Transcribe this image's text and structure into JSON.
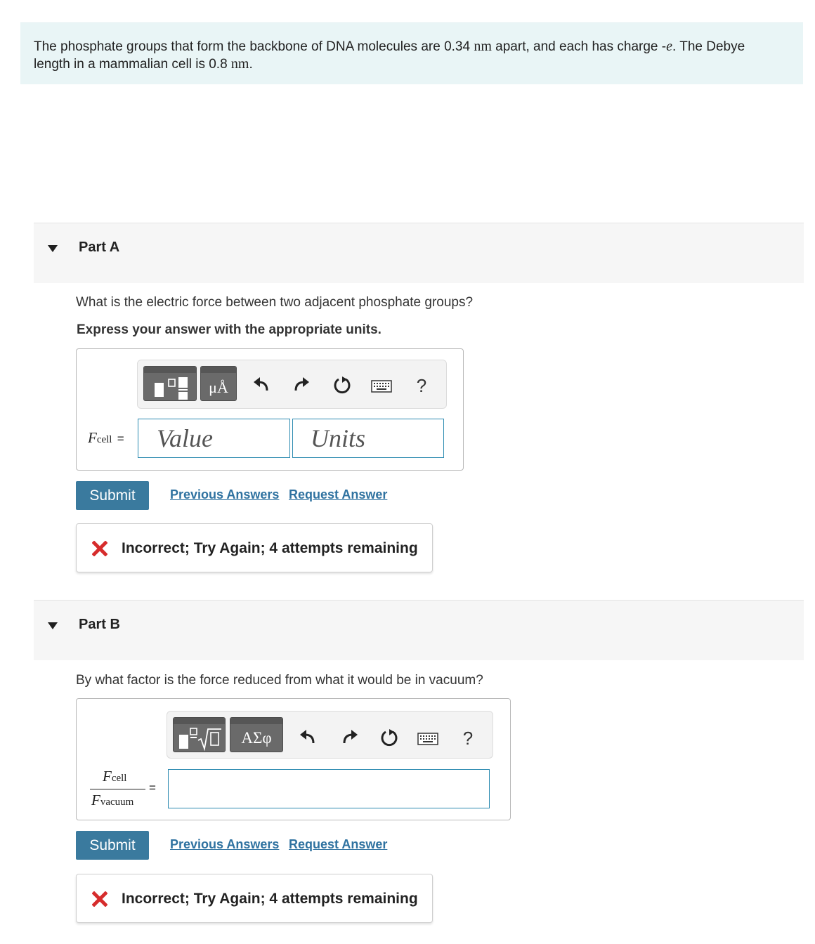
{
  "problem": {
    "text_1": "The phosphate groups that form the backbone of DNA molecules are 0.34",
    "unit_nm_1": "nm",
    "text_2": "apart, and each has charge -",
    "charge_e": "e",
    "text_3": ". The Debye",
    "text_4": "length in a mammalian cell is 0.8",
    "unit_nm_2": "nm",
    "text_5": "."
  },
  "part_a": {
    "title": "Part A",
    "question": "What is the electric force between two adjacent phosphate groups?",
    "instruction": "Express your answer with the appropriate units.",
    "label_var": "F",
    "label_sub": "cell",
    "label_eq": "=",
    "value_placeholder": "Value",
    "units_placeholder": "Units",
    "units_button_label": "μÅ",
    "help_label": "?",
    "submit_label": "Submit",
    "previous_answers_label": "Previous Answers",
    "request_answer_label": "Request Answer",
    "feedback_text": "Incorrect; Try Again; 4 attempts remaining"
  },
  "part_b": {
    "title": "Part B",
    "question": "By what factor is the force reduced from what it would be in vacuum?",
    "num_var": "F",
    "num_sub": "cell",
    "den_var": "F",
    "den_sub": "vacuum",
    "label_eq": "=",
    "answer_value": "",
    "symbols_button_label": "ΑΣφ",
    "help_label": "?",
    "submit_label": "Submit",
    "previous_answers_label": "Previous Answers",
    "request_answer_label": "Request Answer",
    "feedback_text": "Incorrect; Try Again; 4 attempts remaining"
  },
  "colors": {
    "statement_bg": "#e9f5f6",
    "band_bg": "#f6f6f6",
    "submit_bg": "#3a7a9e",
    "link": "#2f72a0",
    "field_border": "#2b8ab0",
    "incorrect": "#d62c2c"
  },
  "icons": [
    "templates-icon",
    "units-icon",
    "undo-icon",
    "redo-icon",
    "reset-icon",
    "keyboard-icon",
    "help-icon",
    "fraction-sqrt-icon",
    "greek-symbols-icon",
    "incorrect-x-icon",
    "collapse-triangle-icon"
  ]
}
